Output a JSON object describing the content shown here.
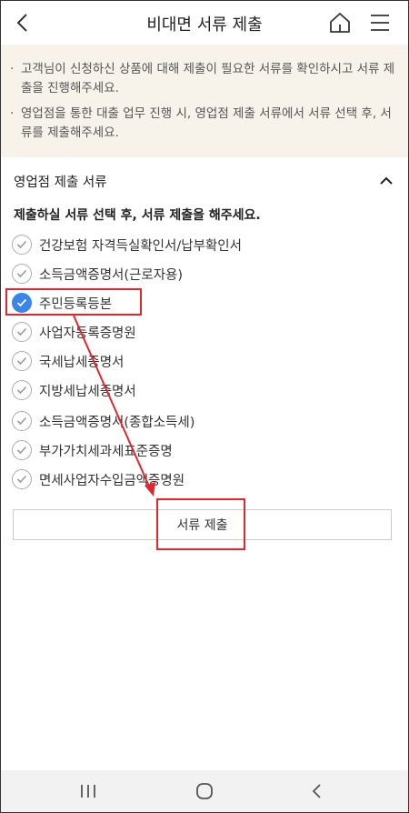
{
  "header": {
    "title": "비대면 서류 제출",
    "back_icon": "chevron-left-icon",
    "home_icon": "home-icon",
    "menu_icon": "hamburger-menu-icon"
  },
  "notice": {
    "items": [
      "고객님이 신청하신 상품에 대해 제출이 필요한 서류를 확인하시고 서류 제출을 진행해주세요.",
      "영업점을 통한 대출 업무 진행 시, 영업점 제출 서류에서 서류 선택 후, 서류를 제출해주세요."
    ]
  },
  "section": {
    "title": "영업점 제출 서류",
    "instruction": "제출하실 서류 선택 후, 서류 제출을 해주세요.",
    "documents": [
      {
        "label": "건강보험 자격득실확인서/납부확인서",
        "checked": false
      },
      {
        "label": "소득금액증명서(근로자용)",
        "checked": false
      },
      {
        "label": "주민등록등본",
        "checked": true
      },
      {
        "label": "사업자등록증명원",
        "checked": false
      },
      {
        "label": "국세납세증명서",
        "checked": false
      },
      {
        "label": "지방세납세증명서",
        "checked": false
      },
      {
        "label": "소득금액증명서(종합소득세)",
        "checked": false
      },
      {
        "label": "부가가치세과세표준증명",
        "checked": false
      },
      {
        "label": "면세사업자수입금액증명원",
        "checked": false
      }
    ],
    "submit_label": "서류 제출"
  },
  "colors": {
    "accent": "#3a85e8",
    "annotation": "#e0262e",
    "notice_bg": "#f7f2ea"
  }
}
